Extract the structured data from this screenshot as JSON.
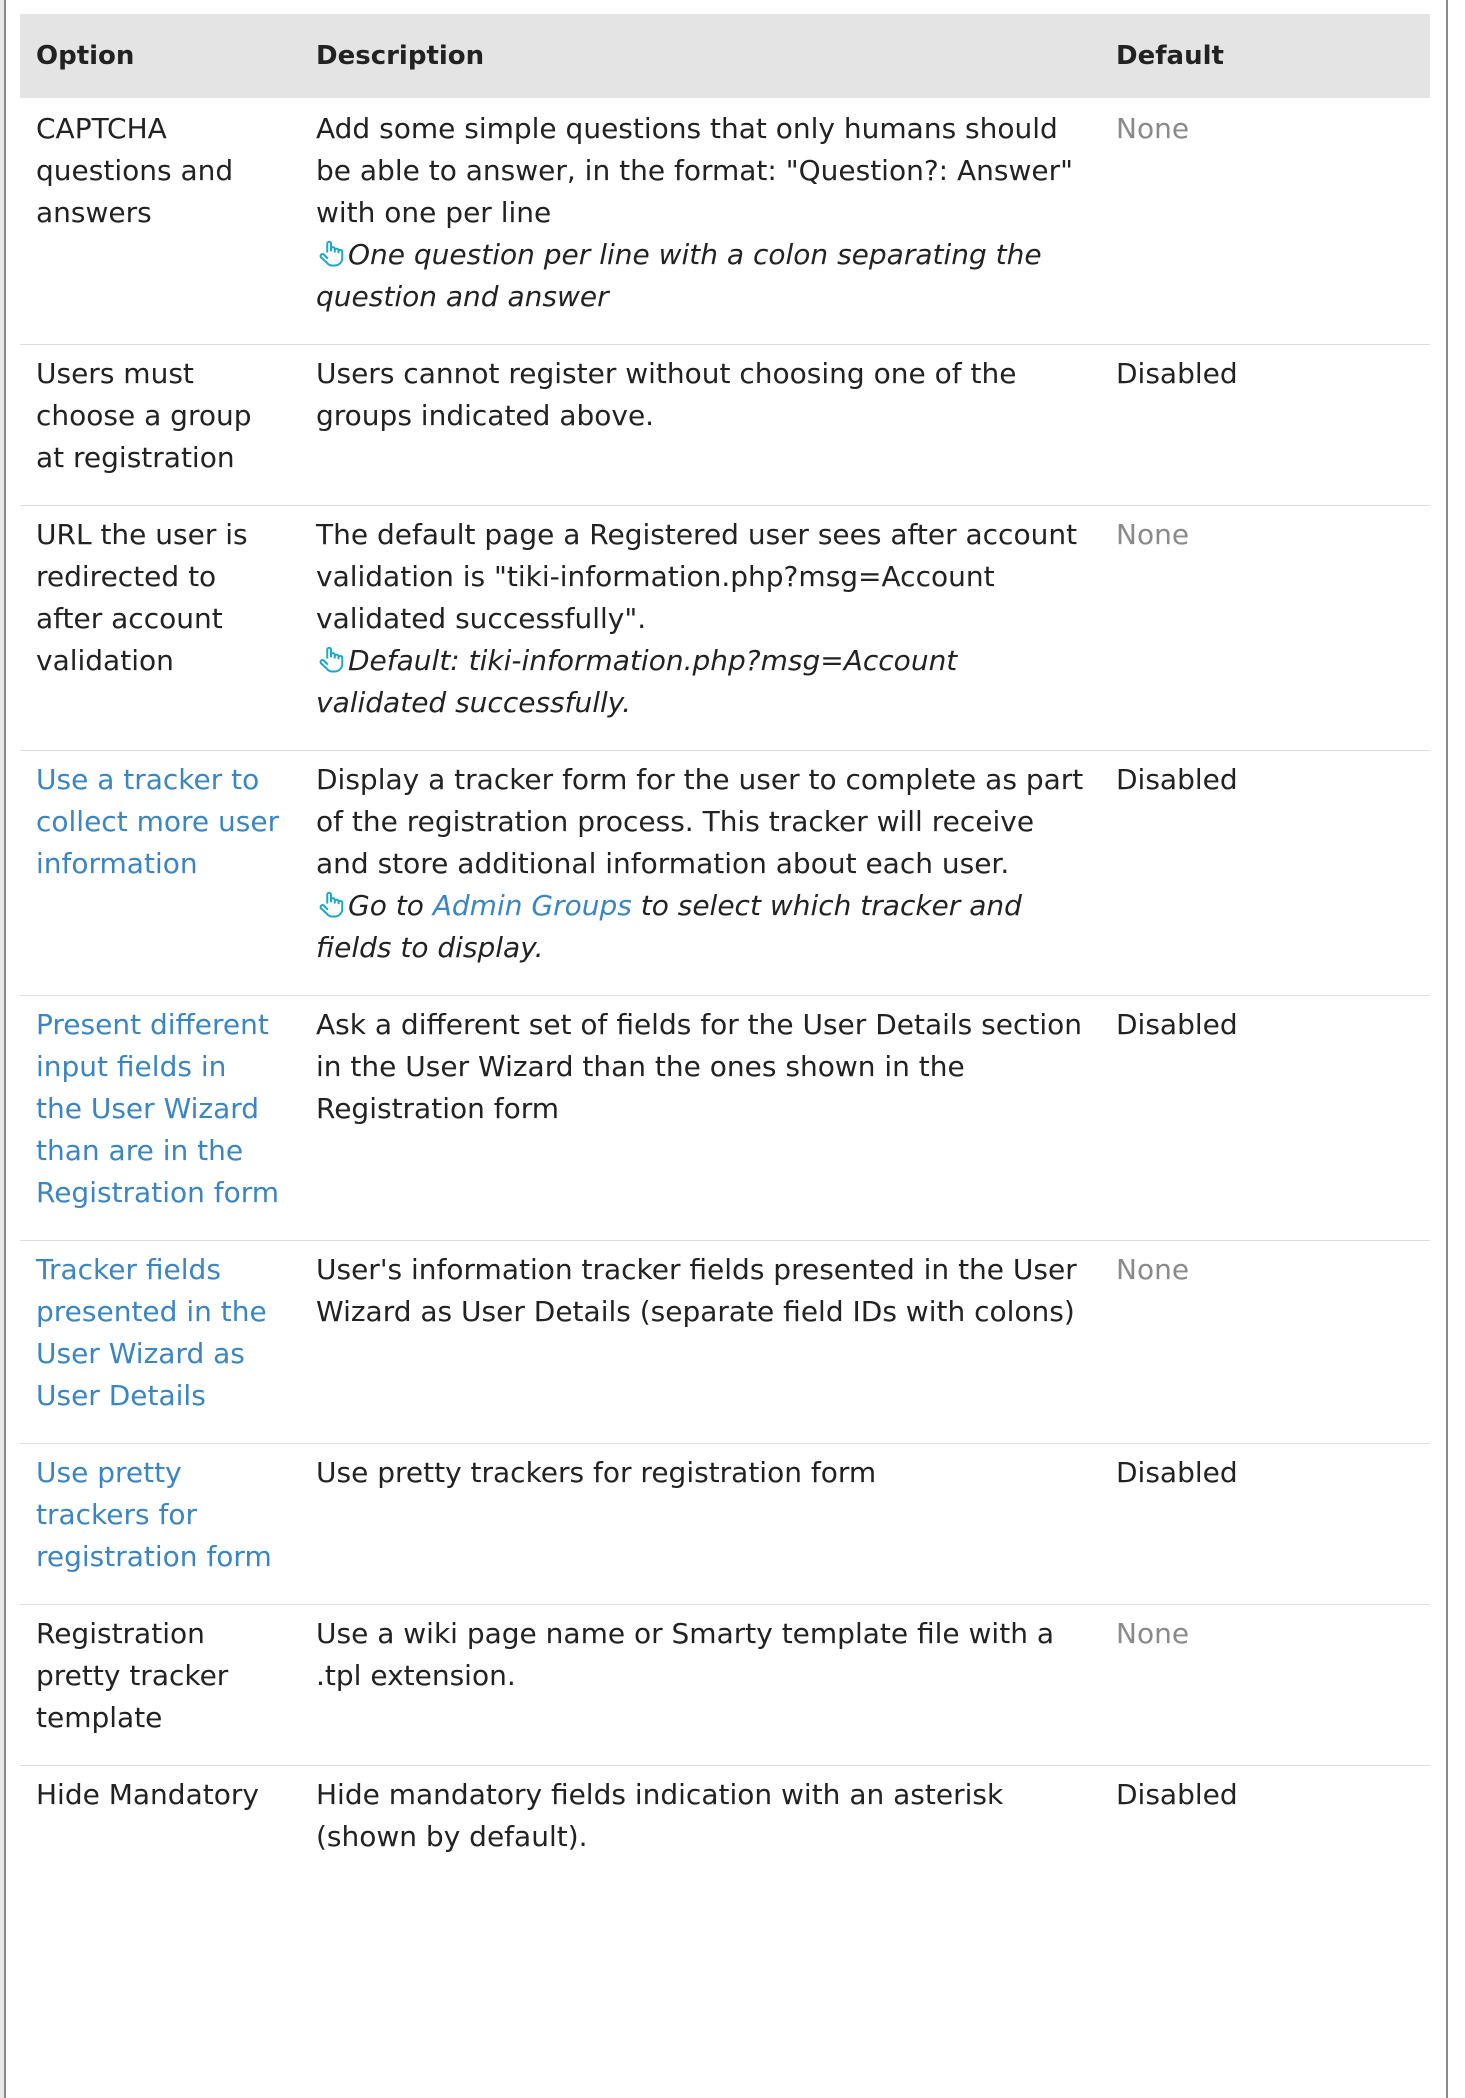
{
  "columns": {
    "option": "Option",
    "description": "Description",
    "default": "Default"
  },
  "rows": [
    {
      "option": "CAPTCHA questions and answers",
      "option_link": false,
      "description": "Add some simple questions that only humans should be able to answer, in the format: \"Question?: Answer\" with one per line",
      "hint_pre": "One question per line with a colon separating the question and answer",
      "hint_link": "",
      "hint_post": "",
      "default": "None",
      "default_muted": true
    },
    {
      "option": "Users must choose a group at registration",
      "option_link": false,
      "description": "Users cannot register without choosing one of the groups indicated above.",
      "hint_pre": "",
      "hint_link": "",
      "hint_post": "",
      "default": "Disabled",
      "default_muted": false
    },
    {
      "option": "URL the user is redirected to after account validation",
      "option_link": false,
      "description": "The default page a Registered user sees after account validation is \"tiki-information.php?msg=Account validated successfully\".",
      "hint_pre": "Default: tiki-information.php?msg=Account validated successfully.",
      "hint_link": "",
      "hint_post": "",
      "default": "None",
      "default_muted": true
    },
    {
      "option": "Use a tracker to collect more user information",
      "option_link": true,
      "description": "Display a tracker form for the user to complete as part of the registration process. This tracker will receive and store additional information about each user.",
      "hint_pre": "Go to ",
      "hint_link": "Admin Groups",
      "hint_post": " to select which tracker and fields to display.",
      "default": "Disabled",
      "default_muted": false
    },
    {
      "option": "Present different input fields in the User Wizard than are in the Registration form",
      "option_link": true,
      "description": "Ask a different set of fields for the User Details section in the User Wizard than the ones shown in the Registration form",
      "hint_pre": "",
      "hint_link": "",
      "hint_post": "",
      "default": "Disabled",
      "default_muted": false
    },
    {
      "option": "Tracker fields presented in the User Wizard as User Details",
      "option_link": true,
      "description": "User's information tracker fields presented in the User Wizard as User Details (separate field IDs with colons)",
      "hint_pre": "",
      "hint_link": "",
      "hint_post": "",
      "default": "None",
      "default_muted": true
    },
    {
      "option": "Use pretty trackers for registration form",
      "option_link": true,
      "description": "Use pretty trackers for registration form",
      "hint_pre": "",
      "hint_link": "",
      "hint_post": "",
      "default": "Disabled",
      "default_muted": false
    },
    {
      "option": "Registration pretty tracker template",
      "option_link": false,
      "description": "Use a wiki page name or Smarty template file with a .tpl extension.",
      "hint_pre": "",
      "hint_link": "",
      "hint_post": "",
      "default": "None",
      "default_muted": true
    },
    {
      "option": "Hide Mandatory",
      "option_link": false,
      "description": "Hide mandatory fields indication with an asterisk (shown by default).",
      "hint_pre": "",
      "hint_link": "",
      "hint_post": "",
      "default": "Disabled",
      "default_muted": false
    }
  ],
  "hint_icon": "hand-pointer-icon",
  "colors": {
    "link": "#3b86c2",
    "muted": "#8a8a8a",
    "header_bg": "#e4e4e4",
    "hint_icon": "#1aa9c9"
  }
}
